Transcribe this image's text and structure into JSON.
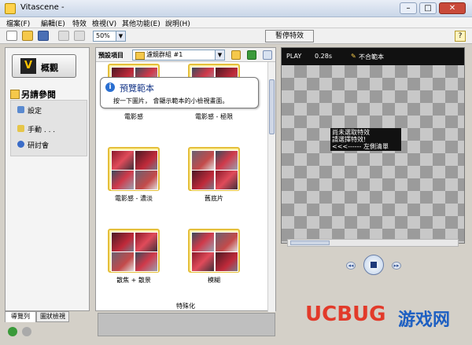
{
  "window": {
    "title": "Vitascene -",
    "min": "–",
    "max": "□",
    "close": "✕"
  },
  "menu": [
    "檔案(F)",
    "編輯(E)",
    "特效",
    "檢視(V)",
    "其他功能(E)",
    "說明(H)"
  ],
  "toolbar": {
    "zoom": "50%",
    "pause": "暫停特效",
    "help_icon": "help-icon"
  },
  "left": {
    "overview": "概觀",
    "logo_letter": "V",
    "ref_heading": "另請參閱",
    "items": [
      "設定",
      "手動 . . .",
      "研討會"
    ],
    "tabs": [
      "導覽列",
      "圖狀檢視"
    ]
  },
  "center": {
    "header_label": "預設項目",
    "group": "濾鏡群組 #1",
    "thumbs": [
      "電影感",
      "電影感 - 極限",
      "電影感 - 濃淡",
      "舊底片",
      "散焦 + 散景",
      "模糊"
    ],
    "tooltip_title": "預覽範本",
    "tooltip_body": "按一下圖片， 會顯示範本的小檢視畫面。",
    "footer": "特殊化"
  },
  "preview": {
    "state": "PLAY",
    "time": "0.28s",
    "mode": "不合範本",
    "hint": [
      "尚未選取特效",
      "請選擇特效!",
      "<<<------ 左側清單"
    ]
  },
  "watermark": {
    "brand": "UCBUG",
    "site": "游戏网",
    "url": ".com"
  },
  "colors": {
    "accent": "#e5bf3a",
    "brand_red": "#e23a2a",
    "brand_blue": "#1d5fc2"
  }
}
